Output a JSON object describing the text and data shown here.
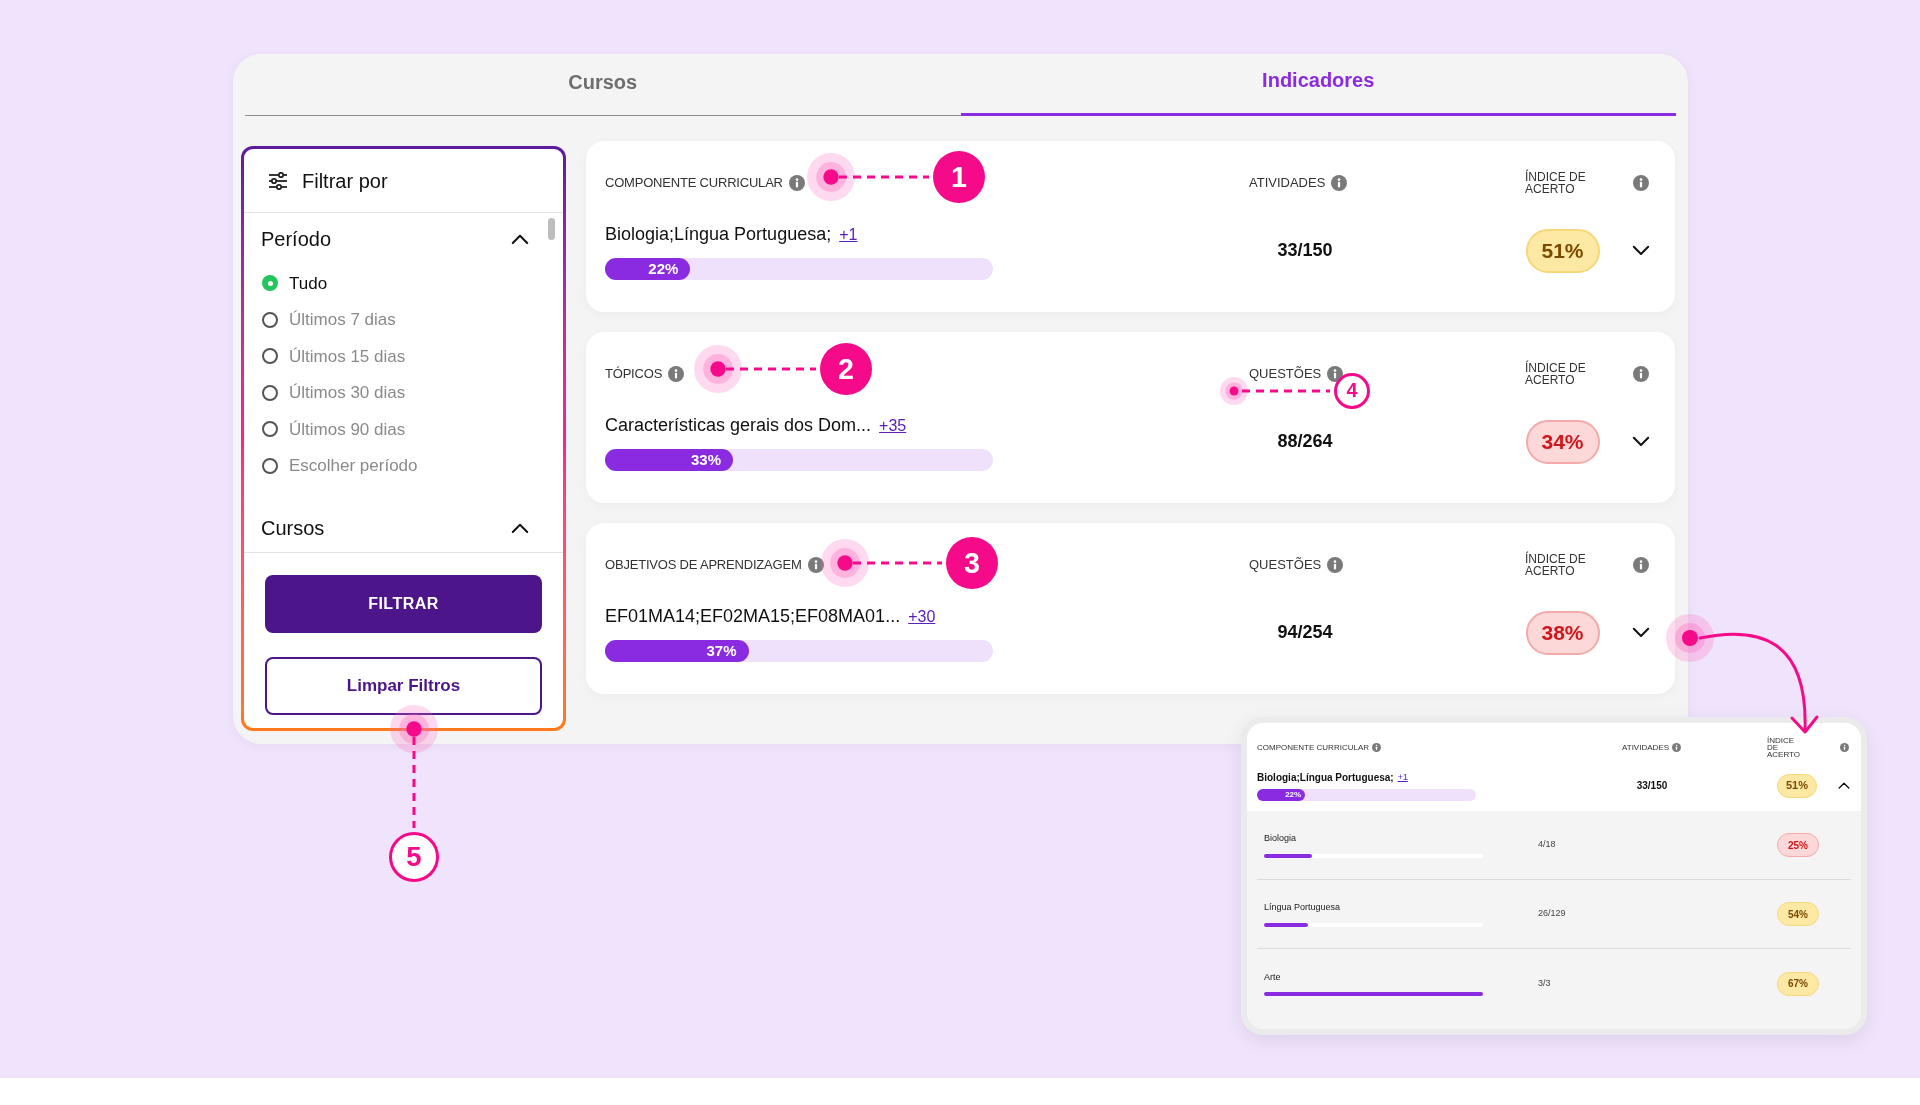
{
  "tabs": [
    {
      "label": "Cursos",
      "selected": false
    },
    {
      "label": "Indicadores",
      "selected": true
    }
  ],
  "filter": {
    "title": "Filtrar por",
    "sections": [
      {
        "title": "Período",
        "expanded": true,
        "options": [
          {
            "label": "Tudo",
            "selected": true
          },
          {
            "label": "Últimos 7 dias",
            "selected": false
          },
          {
            "label": "Últimos 15 dias",
            "selected": false
          },
          {
            "label": "Últimos 30 dias",
            "selected": false
          },
          {
            "label": "Últimos 90 dias",
            "selected": false
          },
          {
            "label": "Escolher período",
            "selected": false
          }
        ]
      },
      {
        "title": "Cursos",
        "expanded": true
      }
    ],
    "primary_button": "FILTRAR",
    "secondary_button": "Limpar Filtros"
  },
  "cards": [
    {
      "header": "COMPONENTE CURRICULAR",
      "value_header": "ATIVIDADES",
      "score_header": "ÍNDICE DE ACERTO",
      "name": "Biologia;Língua Portuguesa;",
      "more": "+1",
      "progress": "22%",
      "level": 0.22,
      "value": "33/150",
      "score": "51%",
      "kind": "warning",
      "expanded": false
    },
    {
      "header": "TÓPICOS",
      "value_header": "QUESTÕES",
      "score_header": "ÍNDICE DE ACERTO",
      "name": "Características gerais dos Dom...",
      "more": "+35",
      "progress": "33%",
      "level": 0.33,
      "value": "88/264",
      "score": "34%",
      "kind": "danger",
      "expanded": false
    },
    {
      "header": "OBJETIVOS DE APRENDIZAGEM",
      "value_header": "QUESTÕES",
      "score_header": "ÍNDICE DE ACERTO",
      "name": "EF01MA14;EF02MA15;EF08MA01...",
      "more": "+30",
      "progress": "37%",
      "level": 0.37,
      "value": "94/254",
      "score": "38%",
      "kind": "danger",
      "expanded": false
    }
  ],
  "detail": {
    "header": "COMPONENTE CURRICULAR",
    "value_header": "ATIVIDADES",
    "score_header": "ÍNDICE DE ACERTO",
    "name": "Biologia;Língua Portuguesa;",
    "more": "+1",
    "progress": "22%",
    "level": 0.22,
    "value": "33/150",
    "score": "51%",
    "kind": "warning",
    "expanded": true,
    "rows": [
      {
        "name": "Biologia",
        "level": 0.22,
        "value": "4/18",
        "score": "25%",
        "kind": "danger"
      },
      {
        "name": "Língua Portuguesa",
        "level": 0.2,
        "value": "26/129",
        "score": "54%",
        "kind": "warning"
      },
      {
        "name": "Arte",
        "level": 1,
        "value": "3/3",
        "score": "67%",
        "kind": "warning"
      }
    ]
  },
  "annotations": [
    {
      "label": "1",
      "kind": "filled"
    },
    {
      "label": "2",
      "kind": "filled"
    },
    {
      "label": "3",
      "kind": "filled"
    },
    {
      "label": "4",
      "kind": "outline"
    },
    {
      "label": "5",
      "kind": "outline"
    }
  ]
}
